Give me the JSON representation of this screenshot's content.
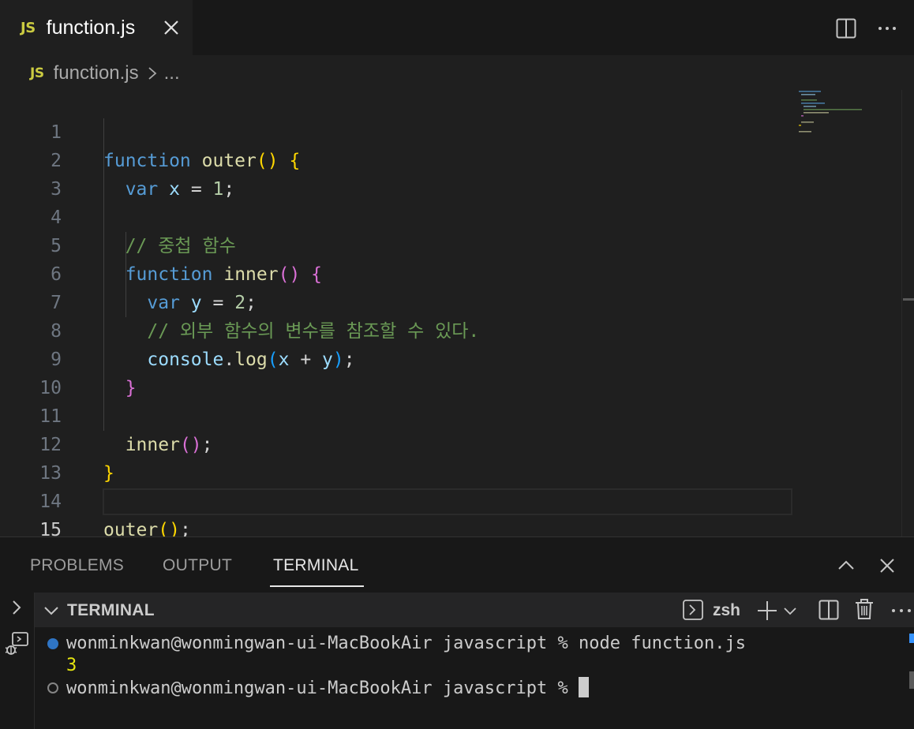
{
  "tab": {
    "badge": "JS",
    "title": "function.js"
  },
  "breadcrumb": {
    "badge": "JS",
    "file": "function.js",
    "more": "..."
  },
  "editor": {
    "lines": [
      {
        "n": "1"
      },
      {
        "n": "2"
      },
      {
        "n": "3"
      },
      {
        "n": "4"
      },
      {
        "n": "5"
      },
      {
        "n": "6"
      },
      {
        "n": "7"
      },
      {
        "n": "8"
      },
      {
        "n": "9"
      },
      {
        "n": "10"
      },
      {
        "n": "11"
      },
      {
        "n": "12"
      },
      {
        "n": "13"
      },
      {
        "n": "14"
      },
      {
        "n": "15"
      }
    ],
    "tokens": {
      "function": "function",
      "outer": "outer",
      "inner": "inner",
      "var": "var",
      "x": "x",
      "y": "y",
      "one": "1",
      "two": "2",
      "console": "console",
      "log": "log",
      "comment1": "// 중첩 함수",
      "comment2": "// 외부 함수의 변수를 참조할 수 있다."
    }
  },
  "panel": {
    "tabs": [
      "PROBLEMS",
      "OUTPUT",
      "TERMINAL"
    ],
    "terminal_title": "TERMINAL",
    "shell": "zsh"
  },
  "terminal": {
    "prompt1": "wonminkwan@wonmingwan-ui-MacBookAir javascript % node function.js",
    "output": "3",
    "prompt2": "wonminkwan@wonmingwan-ui-MacBookAir javascript % "
  },
  "colors": {
    "keyword": "#569cd6",
    "function": "#dcdcaa",
    "variable": "#9cdcfe",
    "number": "#b5cea8",
    "comment": "#6a9955",
    "js_badge": "#cbcb41",
    "terminal_output": "#e5e510"
  }
}
